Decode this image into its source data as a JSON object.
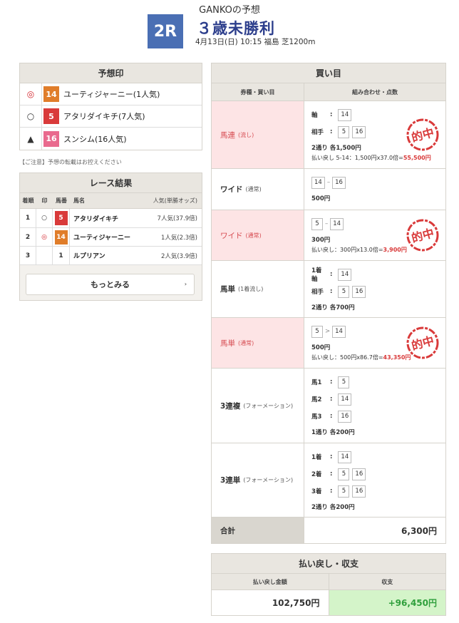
{
  "header": {
    "owner_title": "GANKOの予想",
    "race_number": "2R",
    "race_name": "３歳未勝利",
    "race_info": "4月13日(日) 10:15 福島 芝1200m"
  },
  "prediction": {
    "title": "予想印",
    "items": [
      {
        "mark": "◎",
        "number": "14",
        "color": "#e07d2a",
        "name": "ユーティジャーニー",
        "popularity": "(1人気)"
      },
      {
        "mark": "○",
        "number": "5",
        "color": "#d93a3a",
        "name": "アタリダイキチ",
        "popularity": "(7人気)"
      },
      {
        "mark": "▲",
        "number": "16",
        "color": "#e96a8e",
        "name": "スンシム",
        "popularity": "(16人気)"
      }
    ]
  },
  "notice": "【ご注意】予想の転載はお控えください",
  "results": {
    "title": "レース結果",
    "headers": {
      "pos": "着順",
      "mark": "印",
      "num": "馬番",
      "name": "馬名",
      "pop": "人気(単勝オッズ)"
    },
    "rows": [
      {
        "pos": "1",
        "mark": "○",
        "num": "5",
        "name": "アタリダイキチ",
        "pop": "7人気(37.9倍)"
      },
      {
        "pos": "2",
        "mark": "◎",
        "num": "14",
        "name": "ユーティジャーニー",
        "pop": "1人気(2.3倍)"
      },
      {
        "pos": "3",
        "mark": "",
        "num": "1",
        "name": "ルプリアン",
        "pop": "2人気(3.9倍)"
      }
    ],
    "more_label": "もっとみる",
    "more_chevron": "›"
  },
  "bets": {
    "title": "買い目",
    "head_type": "券種・買い目",
    "head_combo": "組み合わせ・点数",
    "stamp_text": "的中",
    "rows": [
      {
        "type": "馬連",
        "sub": "(流し)",
        "hit": true,
        "lines": [
          {
            "label": "軸",
            "colon": ":",
            "boxes": [
              "14"
            ]
          },
          {
            "label": "相手",
            "colon": ":",
            "boxes": [
              "5",
              "16"
            ]
          }
        ],
        "sum": "2通り 各1,500円",
        "payout_prefix": "払い戻し 5-14：1,500円x37.0倍=",
        "payout_value": "55,500円"
      },
      {
        "type": "ワイド",
        "sub": "(通常)",
        "hit": false,
        "pair": [
          "14",
          "16"
        ],
        "pair_sep": "–",
        "sum": "500円"
      },
      {
        "type": "ワイド",
        "sub": "(通常)",
        "hit": true,
        "pair": [
          "5",
          "14"
        ],
        "pair_sep": "–",
        "sum": "300円",
        "payout_prefix": "払い戻し：300円x13.0倍=",
        "payout_value": "3,900円"
      },
      {
        "type": "馬単",
        "sub": "(1着流し)",
        "hit": false,
        "lines": [
          {
            "label": "1着軸",
            "colon": ":",
            "boxes": [
              "14"
            ]
          },
          {
            "label": "相手",
            "colon": ":",
            "boxes": [
              "5",
              "16"
            ]
          }
        ],
        "sum": "2通り 各700円"
      },
      {
        "type": "馬単",
        "sub": "(通常)",
        "hit": true,
        "pair": [
          "5",
          "14"
        ],
        "pair_sep": ">",
        "sum": "500円",
        "payout_prefix": "払い戻し：500円x86.7倍=",
        "payout_value": "43,350円"
      },
      {
        "type": "3連複",
        "sub": "(フォーメーション)",
        "hit": false,
        "lines": [
          {
            "label": "馬1",
            "colon": ":",
            "boxes": [
              "5"
            ]
          },
          {
            "label": "馬2",
            "colon": ":",
            "boxes": [
              "14"
            ]
          },
          {
            "label": "馬3",
            "colon": ":",
            "boxes": [
              "16"
            ]
          }
        ],
        "sum": "1通り 各200円"
      },
      {
        "type": "3連単",
        "sub": "(フォーメーション)",
        "hit": false,
        "lines": [
          {
            "label": "1着",
            "colon": ":",
            "boxes": [
              "14"
            ]
          },
          {
            "label": "2着",
            "colon": ":",
            "boxes": [
              "5",
              "16"
            ]
          },
          {
            "label": "3着",
            "colon": ":",
            "boxes": [
              "5",
              "16"
            ]
          }
        ],
        "sum": "2通り 各200円"
      }
    ],
    "total_label": "合計",
    "total_value": "6,300円"
  },
  "summary": {
    "title": "払い戻し・収支",
    "head_payout": "払い戻し金額",
    "head_profit": "収支",
    "payout": "102,750円",
    "profit": "+96,450円"
  },
  "colors": {
    "accent_blue": "#4a6fb4",
    "hit_bg": "#fde4e5",
    "stamp_red": "#d93a3a",
    "profit_green": "#2f9f3c"
  }
}
